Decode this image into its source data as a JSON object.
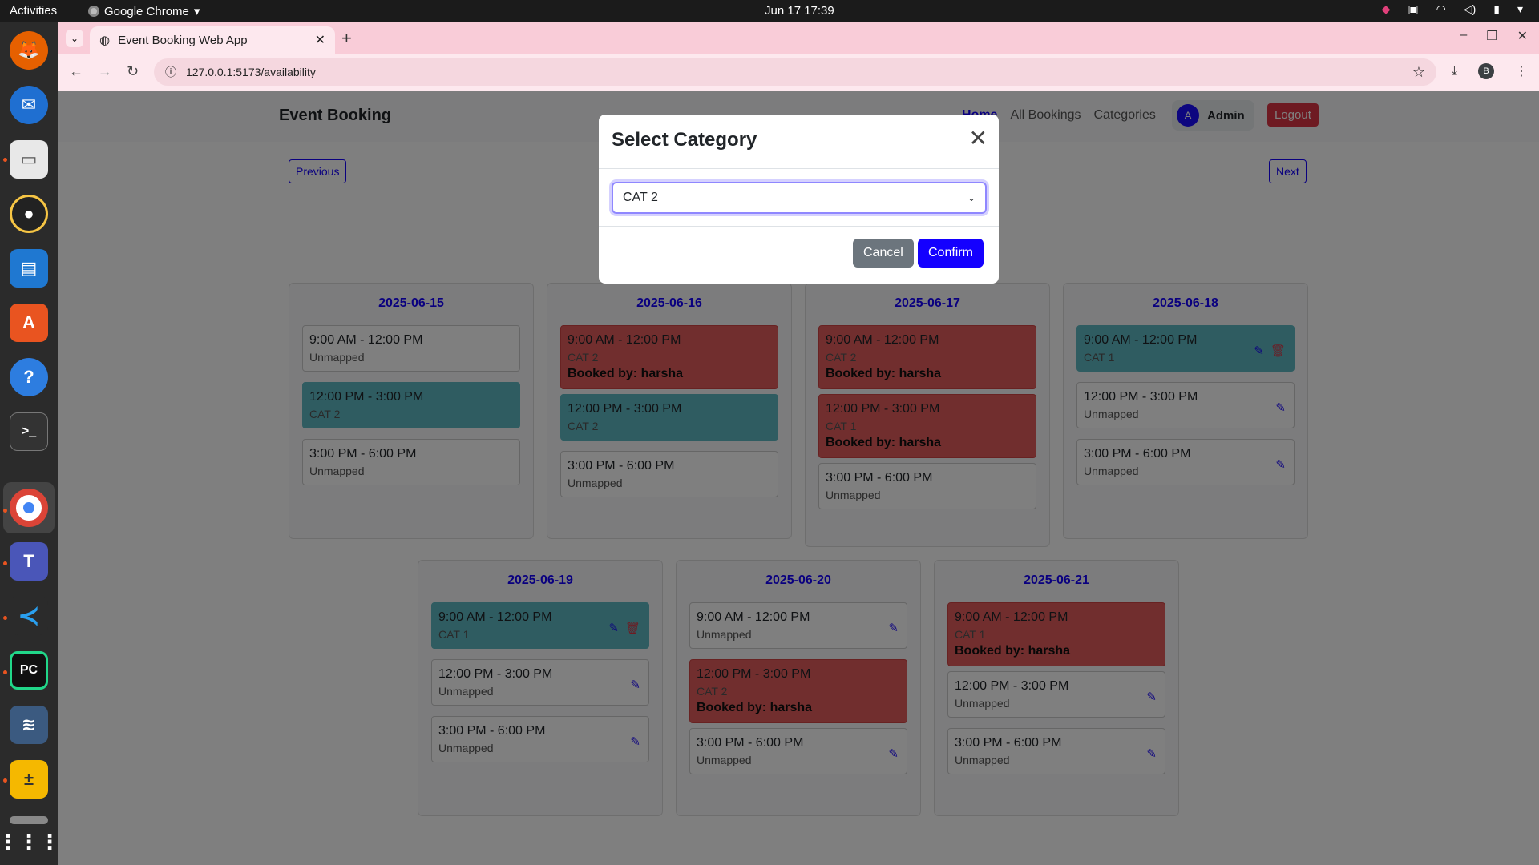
{
  "os": {
    "activities": "Activities",
    "app_name": "Google Chrome",
    "clock": "Jun 17  17:39"
  },
  "browser": {
    "tab_title": "Event Booking Web App",
    "url": "127.0.0.1:5173/availability",
    "profile_initial": "B"
  },
  "app": {
    "brand": "Event Booking",
    "nav": [
      "Home",
      "All Bookings",
      "Categories"
    ],
    "user_initial": "A",
    "user_name": "Admin",
    "logout": "Logout",
    "previous": "Previous",
    "next": "Next"
  },
  "days": [
    {
      "date": "2025-06-15",
      "slots": [
        {
          "time": "9:00 AM - 12:00 PM",
          "sub": "Unmapped",
          "state": "unmapped",
          "booked": ""
        },
        {
          "time": "12:00 PM - 3:00 PM",
          "sub": "CAT 2",
          "state": "mapped",
          "booked": ""
        },
        {
          "time": "3:00 PM - 6:00 PM",
          "sub": "Unmapped",
          "state": "unmapped",
          "booked": ""
        }
      ]
    },
    {
      "date": "2025-06-16",
      "slots": [
        {
          "time": "9:00 AM - 12:00 PM",
          "sub": "CAT 2",
          "state": "booked",
          "booked": "Booked by: harsha"
        },
        {
          "time": "12:00 PM - 3:00 PM",
          "sub": "CAT 2",
          "state": "mapped",
          "booked": ""
        },
        {
          "time": "3:00 PM - 6:00 PM",
          "sub": "Unmapped",
          "state": "unmapped",
          "booked": ""
        }
      ]
    },
    {
      "date": "2025-06-17",
      "slots": [
        {
          "time": "9:00 AM - 12:00 PM",
          "sub": "CAT 2",
          "state": "booked",
          "booked": "Booked by: harsha"
        },
        {
          "time": "12:00 PM - 3:00 PM",
          "sub": "CAT 1",
          "state": "booked",
          "booked": "Booked by: harsha"
        },
        {
          "time": "3:00 PM - 6:00 PM",
          "sub": "Unmapped",
          "state": "unmapped",
          "booked": ""
        }
      ]
    },
    {
      "date": "2025-06-18",
      "slots": [
        {
          "time": "9:00 AM - 12:00 PM",
          "sub": "CAT 1",
          "state": "mapped",
          "booked": ""
        },
        {
          "time": "12:00 PM - 3:00 PM",
          "sub": "Unmapped",
          "state": "unmapped",
          "booked": ""
        },
        {
          "time": "3:00 PM - 6:00 PM",
          "sub": "Unmapped",
          "state": "unmapped",
          "booked": ""
        }
      ]
    },
    {
      "date": "2025-06-19",
      "slots": [
        {
          "time": "9:00 AM - 12:00 PM",
          "sub": "CAT 1",
          "state": "mapped",
          "booked": ""
        },
        {
          "time": "12:00 PM - 3:00 PM",
          "sub": "Unmapped",
          "state": "unmapped",
          "booked": ""
        },
        {
          "time": "3:00 PM - 6:00 PM",
          "sub": "Unmapped",
          "state": "unmapped",
          "booked": ""
        }
      ]
    },
    {
      "date": "2025-06-20",
      "slots": [
        {
          "time": "9:00 AM - 12:00 PM",
          "sub": "Unmapped",
          "state": "unmapped",
          "booked": ""
        },
        {
          "time": "12:00 PM - 3:00 PM",
          "sub": "CAT 2",
          "state": "booked",
          "booked": "Booked by: harsha"
        },
        {
          "time": "3:00 PM - 6:00 PM",
          "sub": "Unmapped",
          "state": "unmapped",
          "booked": ""
        }
      ]
    },
    {
      "date": "2025-06-21",
      "slots": [
        {
          "time": "9:00 AM - 12:00 PM",
          "sub": "CAT 1",
          "state": "booked",
          "booked": "Booked by: harsha"
        },
        {
          "time": "12:00 PM - 3:00 PM",
          "sub": "Unmapped",
          "state": "unmapped",
          "booked": ""
        },
        {
          "time": "3:00 PM - 6:00 PM",
          "sub": "Unmapped",
          "state": "unmapped",
          "booked": ""
        }
      ]
    }
  ],
  "modal": {
    "title": "Select Category",
    "selected": "CAT 2",
    "cancel": "Cancel",
    "confirm": "Confirm"
  },
  "colors": {
    "primary": "#1400ff",
    "mapped": "#5fb8c2",
    "booked": "#e35d5d",
    "danger": "#dc3545"
  }
}
